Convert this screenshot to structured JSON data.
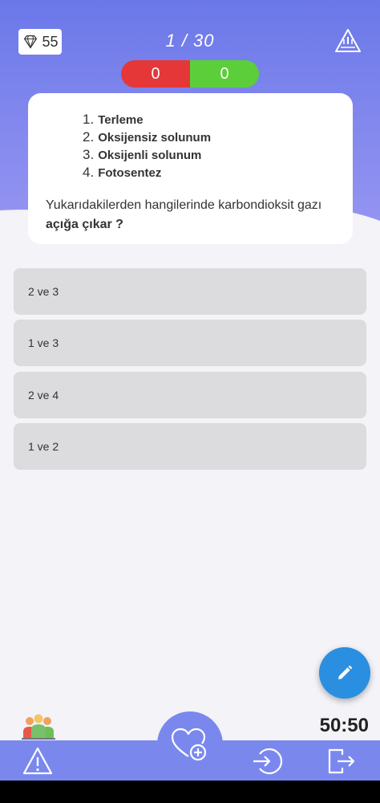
{
  "header": {
    "gems": "55",
    "progress": "1 / 30",
    "score_wrong": "0",
    "score_right": "0"
  },
  "question": {
    "items": [
      {
        "num": "1.",
        "text": "Terleme"
      },
      {
        "num": "2.",
        "text": "Oksijensiz solunum"
      },
      {
        "num": "3.",
        "text": "Oksijenli solunum"
      },
      {
        "num": "4.",
        "text": "Fotosentez"
      }
    ],
    "prompt_plain": "Yukarıdakilerden hangilerinde karbondioksit gazı ",
    "prompt_bold": "açığa çıkar ?"
  },
  "options": [
    "2 ve 3",
    "1 ve 3",
    "2 ve 4",
    "1 ve 2"
  ],
  "timer": "50:50",
  "colors": {
    "header_gradient_top": "#6e7bea",
    "header_gradient_bottom": "#8f93f0",
    "wrong": "#e53737",
    "right": "#5cce3a",
    "fab": "#2a8fe0",
    "bottom_bar": "#7a88ee"
  },
  "icons": {
    "gem": "diamond-icon",
    "report_top": "warning-icon",
    "edit": "pencil-icon",
    "people": "people-icon",
    "warning_bottom": "warning-icon",
    "heart": "heart-plus-icon",
    "enter": "sign-in-icon",
    "exit": "sign-out-icon"
  }
}
